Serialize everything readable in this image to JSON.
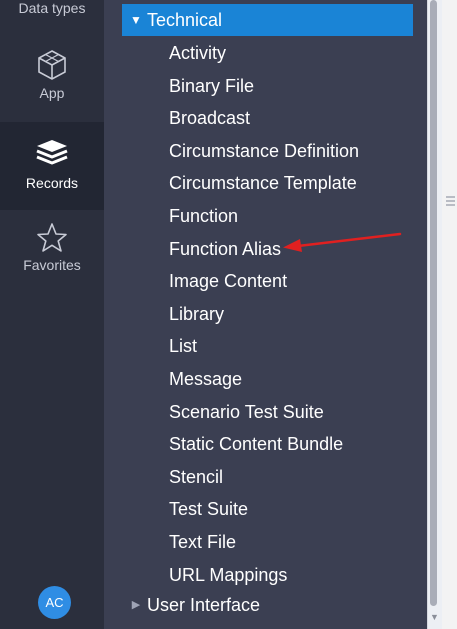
{
  "rail": {
    "items": [
      {
        "label": "Data types",
        "icon": "data-types-icon"
      },
      {
        "label": "App",
        "icon": "cube-icon"
      },
      {
        "label": "Records",
        "icon": "layers-icon",
        "active": true
      },
      {
        "label": "Favorites",
        "icon": "star-icon"
      }
    ],
    "avatar": "AC"
  },
  "tree": {
    "technical": {
      "label": "Technical",
      "items": [
        "Activity",
        "Binary File",
        "Broadcast",
        "Circumstance Definition",
        "Circumstance Template",
        "Function",
        "Function Alias",
        "Image Content",
        "Library",
        "List",
        "Message",
        "Scenario Test Suite",
        "Static Content Bundle",
        "Stencil",
        "Test Suite",
        "Text File",
        "URL Mappings"
      ]
    },
    "user_interface": {
      "label": "User Interface"
    }
  },
  "colors": {
    "rail_bg": "#2b2f3d",
    "panel_bg": "#3b3f52",
    "selection": "#1a84d6",
    "annotation": "#e02020",
    "avatar": "#2f8de4"
  }
}
